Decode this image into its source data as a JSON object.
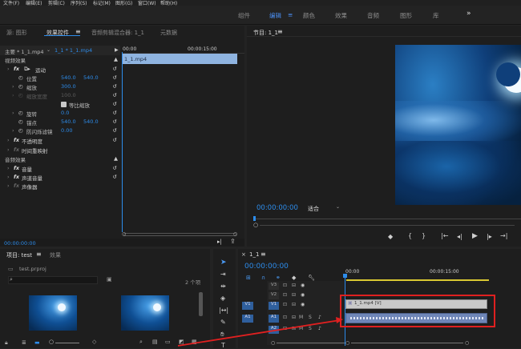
{
  "menu": [
    "文件(F)",
    "编辑(E)",
    "剪辑(C)",
    "序列(S)",
    "标记(M)",
    "图形(G)",
    "窗口(W)",
    "帮助(H)"
  ],
  "workspaces": [
    "组件",
    "编辑",
    "颜色",
    "效果",
    "音频",
    "图形",
    "库"
  ],
  "workspace_active": "编辑",
  "workspace_menu_icon": "≡",
  "workspace_more": "»",
  "source_tabs": {
    "source": "源: 图形",
    "effect_controls": "效果控件",
    "audio_mixer": "音频剪辑混合器: 1_1",
    "metadata": "元数据"
  },
  "effect_controls": {
    "master": "主要 * 1_1.mp4",
    "clip": "1_1 * 1_1.mp4",
    "time_start": "00:00",
    "time_end": "00:00:15:00",
    "clip_bar_label": "1_1.mp4",
    "video_effects": "视频效果",
    "motion": "运动",
    "position": {
      "label": "位置",
      "x": "540.0",
      "y": "540.0"
    },
    "scale": {
      "label": "缩放",
      "value": "300.0"
    },
    "scale_width": {
      "label": "缩放宽度",
      "value": "100.0"
    },
    "uniform_scale": "等比缩放",
    "rotation": {
      "label": "旋转",
      "value": "0.0"
    },
    "anchor": {
      "label": "锚点",
      "x": "540.0",
      "y": "540.0"
    },
    "anti_flicker": {
      "label": "防闪烁滤镜",
      "value": "0.00"
    },
    "opacity": "不透明度",
    "time_remap": "时间重映射",
    "audio_effects": "音频效果",
    "volume": "音量",
    "channel_volume": "声道音量",
    "panner": "声像器",
    "timecode": "00:00:00:00"
  },
  "program": {
    "tab": "节目: 1_1",
    "timecode": "00:00:00:00",
    "fit": "适合"
  },
  "project": {
    "tab": "项目: test",
    "effects_tab": "效果",
    "file": "test.prproj",
    "count": "2 个项",
    "search_placeholder": ""
  },
  "timeline": {
    "tab": "1_1",
    "timecode": "00:00:00:00",
    "ruler_start": "00:00",
    "ruler_end": "00:00:15:00",
    "clip_label": "1_1.mp4 [V]",
    "tracks": [
      {
        "id": "V3",
        "source": ""
      },
      {
        "id": "V2",
        "source": ""
      },
      {
        "id": "V1",
        "source": "V1"
      },
      {
        "id": "A1",
        "source": "A1"
      },
      {
        "id": "A2",
        "source": ""
      }
    ]
  },
  "colors": {
    "accent": "#2d8ceb",
    "annotation": "#e02020",
    "clip_video": "#c9c9c9",
    "clip_audio": "#6f86b8"
  }
}
